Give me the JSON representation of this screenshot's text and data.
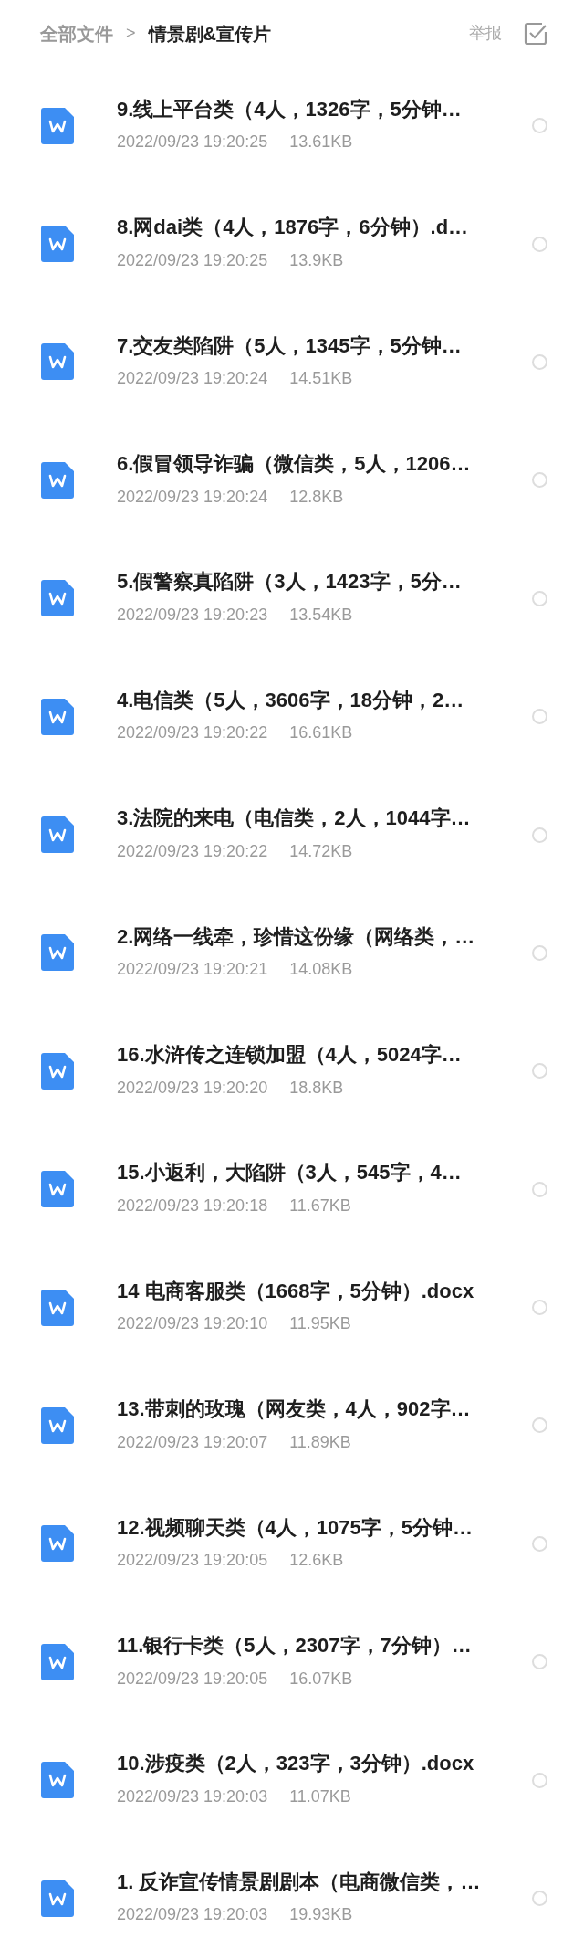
{
  "breadcrumb": [
    {
      "label": "全部文件",
      "current": false
    },
    {
      "label": ">",
      "kind": "separator"
    },
    {
      "label": "情景剧&宣传片",
      "current": true
    }
  ],
  "report_button": "举报",
  "files": [
    {
      "title": "9.线上平台类（4人，1326字，5分钟…",
      "modified": "2022/09/23 19:20:25",
      "size": "13.61KB",
      "selected": false
    },
    {
      "title": "8.网dai类（4人，1876字，6分钟）.d…",
      "modified": "2022/09/23 19:20:25",
      "size": "13.9KB",
      "selected": false
    },
    {
      "title": "7.交友类陷阱（5人，1345字，5分钟…",
      "modified": "2022/09/23 19:20:24",
      "size": "14.51KB",
      "selected": false
    },
    {
      "title": "6.假冒领导诈骗（微信类，5人，1206…",
      "modified": "2022/09/23 19:20:24",
      "size": "12.8KB",
      "selected": false
    },
    {
      "title": "5.假警察真陷阱（3人，1423字，5分…",
      "modified": "2022/09/23 19:20:23",
      "size": "13.54KB",
      "selected": false
    },
    {
      "title": "4.电信类（5人，3606字，18分钟，2…",
      "modified": "2022/09/23 19:20:22",
      "size": "16.61KB",
      "selected": false
    },
    {
      "title": "3.法院的来电（电信类，2人，1044字…",
      "modified": "2022/09/23 19:20:22",
      "size": "14.72KB",
      "selected": false
    },
    {
      "title": "2.网络一线牵，珍惜这份缘（网络类，…",
      "modified": "2022/09/23 19:20:21",
      "size": "14.08KB",
      "selected": false
    },
    {
      "title": "16.水浒传之连锁加盟（4人，5024字…",
      "modified": "2022/09/23 19:20:20",
      "size": "18.8KB",
      "selected": false
    },
    {
      "title": "15.小返利，大陷阱（3人，545字，4…",
      "modified": "2022/09/23 19:20:18",
      "size": "11.67KB",
      "selected": false
    },
    {
      "title": "14 电商客服类（1668字，5分钟）.docx",
      "modified": "2022/09/23 19:20:10",
      "size": "11.95KB",
      "selected": false
    },
    {
      "title": "13.带刺的玫瑰（网友类，4人，902字…",
      "modified": "2022/09/23 19:20:07",
      "size": "11.89KB",
      "selected": false
    },
    {
      "title": "12.视频聊天类（4人，1075字，5分钟…",
      "modified": "2022/09/23 19:20:05",
      "size": "12.6KB",
      "selected": false
    },
    {
      "title": "11.银行卡类（5人，2307字，7分钟）…",
      "modified": "2022/09/23 19:20:05",
      "size": "16.07KB",
      "selected": false
    },
    {
      "title": "10.涉疫类（2人，323字，3分钟）.docx",
      "modified": "2022/09/23 19:20:03",
      "size": "11.07KB",
      "selected": false
    },
    {
      "title": "1. 反诈宣传情景剧剧本（电商微信类，…",
      "modified": "2022/09/23 19:20:03",
      "size": "19.93KB",
      "selected": false
    }
  ]
}
